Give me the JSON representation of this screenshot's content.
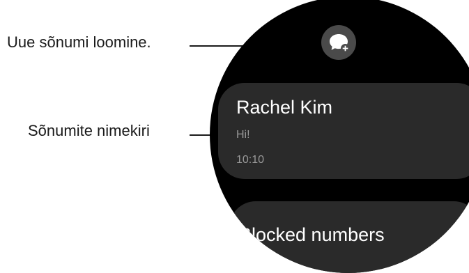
{
  "callouts": {
    "compose": "Uue sõnumi loomine.",
    "list": "Sõnumite nimekiri"
  },
  "messages": [
    {
      "name": "Rachel Kim",
      "preview": "Hi!",
      "time": "10:10"
    }
  ],
  "next_item": {
    "label": "Blocked numbers"
  },
  "icons": {
    "compose": "new-message-icon"
  },
  "colors": {
    "watch_bg": "#000000",
    "card_bg": "#2a2a2a",
    "button_bg": "#4a4a4a",
    "text_primary": "#ffffff",
    "text_secondary": "#9a9a9a"
  }
}
